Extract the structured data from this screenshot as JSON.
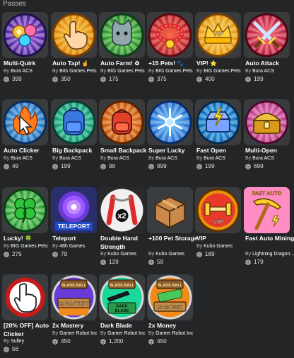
{
  "section": {
    "title": "Passes"
  },
  "colors": {
    "background": "#232527",
    "card": "#393b3d",
    "text": "#ffffff",
    "muted": "#bdbebe"
  },
  "passes": [
    {
      "name": "Multi-Quirk",
      "emoji": "",
      "creator": "Bura ACS",
      "price": "399",
      "icon": "multi-quirk-icon"
    },
    {
      "name": "Auto Tap!",
      "emoji": "☝",
      "creator": "BIG Games Pets",
      "price": "350",
      "icon": "tap-hand-icon"
    },
    {
      "name": "Auto Farm!",
      "emoji": "♻",
      "creator": "BIG Games Pets",
      "price": "175",
      "icon": "cat-pet-icon"
    },
    {
      "name": "+15 Pets!",
      "emoji": "🐾",
      "creator": "BIG Games Pets",
      "price": "375",
      "icon": "pet-collar-icon"
    },
    {
      "name": "VIP!",
      "emoji": "⭐",
      "creator": "BIG Games Pets",
      "price": "400",
      "icon": "vip-crown-icon"
    },
    {
      "name": "Auto Attack",
      "emoji": "",
      "creator": "Bura ACS",
      "price": "199",
      "icon": "crossed-swords-icon"
    },
    {
      "name": "Auto Clicker",
      "emoji": "",
      "creator": "Bura ACS",
      "price": "49",
      "icon": "fire-cursor-icon"
    },
    {
      "name": "Big Backpack",
      "emoji": "",
      "creator": "Bura ACS",
      "price": "199",
      "icon": "blue-backpack-icon"
    },
    {
      "name": "Small Backpack",
      "emoji": "",
      "creator": "Bura ACS",
      "price": "99",
      "icon": "red-backpack-icon"
    },
    {
      "name": "Super Lucky",
      "emoji": "",
      "creator": "Bura ACS",
      "price": "999",
      "icon": "snowflake-icon"
    },
    {
      "name": "Fast Open",
      "emoji": "",
      "creator": "Bura ACS",
      "price": "199",
      "icon": "lightning-chest-icon"
    },
    {
      "name": "Multi-Open",
      "emoji": "",
      "creator": "Bura ACS",
      "price": "699",
      "icon": "gold-chest-icon"
    },
    {
      "name": "Lucky!",
      "emoji": "🍀",
      "creator": "BIG Games Pets",
      "price": "275",
      "icon": "clover-icon"
    },
    {
      "name": "Teleport",
      "emoji": "",
      "creator": "48h Games",
      "price": "79",
      "icon": "portal-icon"
    },
    {
      "name": "Double Hand Strength",
      "emoji": "",
      "creator": "Kubo Games",
      "price": "129",
      "icon": "handgrip-x2-icon"
    },
    {
      "name": "+100 Pet Storage",
      "emoji": "",
      "creator": "Kubo Games",
      "price": "59",
      "icon": "storage-box-icon"
    },
    {
      "name": "VIP",
      "emoji": "",
      "creator": "Kubo Games",
      "price": "189",
      "icon": "vip-dumbbell-icon"
    },
    {
      "name": "Fast Auto Mining",
      "emoji": "",
      "creator": "Lightning Dragon...",
      "price": "179",
      "icon": "gold-pickaxe-icon"
    },
    {
      "name": "[20% OFF] Auto Clicker",
      "emoji": "",
      "creator": "Sulley",
      "price": "56",
      "icon": "hand-cursor-icon"
    },
    {
      "name": "2x Mastery",
      "emoji": "",
      "creator": "Gamer Robot Inc",
      "price": "450",
      "icon": "mastery-sign-icon"
    },
    {
      "name": "Dark Blade",
      "emoji": "",
      "creator": "Gamer Robot Inc",
      "price": "1,200",
      "icon": "dark-blade-icon"
    },
    {
      "name": "2x Money",
      "emoji": "",
      "creator": "Gamer Robot Inc",
      "price": "450",
      "icon": "money-sign-icon"
    }
  ],
  "labels": {
    "by": "By",
    "teleport_badge": "TELEPORT",
    "x2_badge": "x2",
    "vip_text": "VIP",
    "fast_auto_text": "FAST AUTO",
    "mastery_text": "2x MASTERY",
    "dark_blade_text": "DARK BLADE",
    "money_text": "2x MONEY",
    "sign_top_text": "BLADE BALL"
  }
}
